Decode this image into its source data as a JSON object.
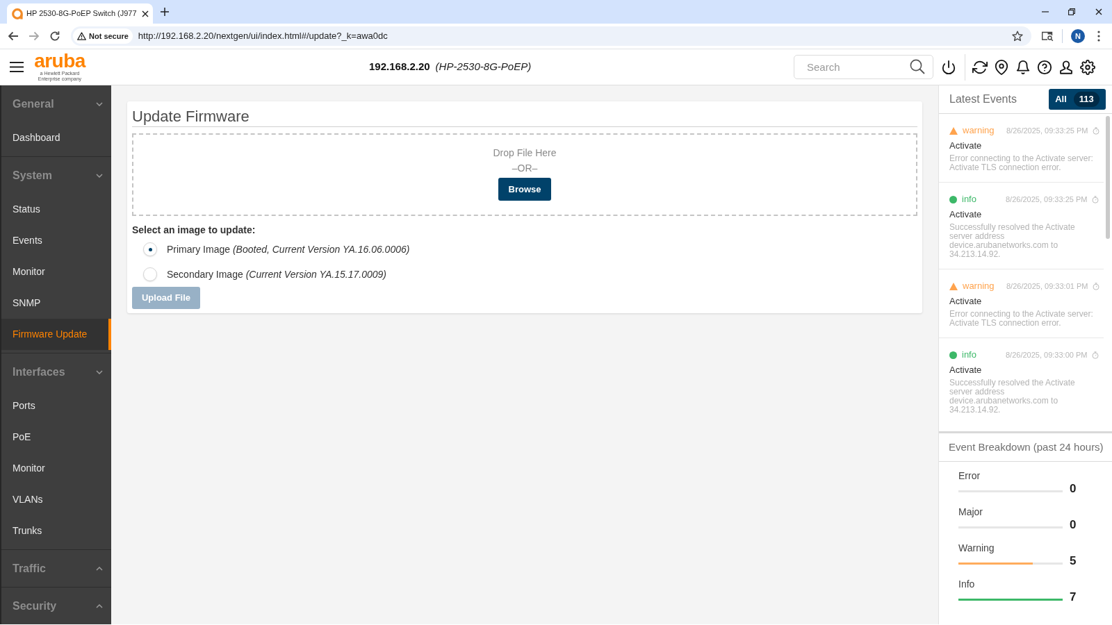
{
  "browser": {
    "tab": {
      "title": "HP 2530-8G-PoEP Switch (J977"
    },
    "security_chip": "Not secure",
    "url": "http://192.168.2.20/nextgen/ui/index.html#/update?_k=awa0dc",
    "profile_initial": "N"
  },
  "header": {
    "logo": {
      "wordmark": "aruba",
      "tagline": "a Hewlett Packard Enterprise company"
    },
    "device_address": "192.168.2.20",
    "device_model": "(HP-2530-8G-PoEP)",
    "search": {
      "placeholder": "Search"
    }
  },
  "sidebar": {
    "sections": [
      {
        "title": "General",
        "expanded": true,
        "items": [
          {
            "label": "Dashboard",
            "selected": false
          }
        ]
      },
      {
        "title": "System",
        "expanded": true,
        "items": [
          {
            "label": "Status",
            "selected": false
          },
          {
            "label": "Events",
            "selected": false
          },
          {
            "label": "Monitor",
            "selected": false
          },
          {
            "label": "SNMP",
            "selected": false
          },
          {
            "label": "Firmware Update",
            "selected": true
          }
        ]
      },
      {
        "title": "Interfaces",
        "expanded": true,
        "items": [
          {
            "label": "Ports",
            "selected": false
          },
          {
            "label": "PoE",
            "selected": false
          },
          {
            "label": "Monitor",
            "selected": false
          },
          {
            "label": "VLANs",
            "selected": false
          },
          {
            "label": "Trunks",
            "selected": false
          }
        ]
      },
      {
        "title": "Traffic",
        "expanded": false
      },
      {
        "title": "Security",
        "expanded": false
      }
    ]
  },
  "update_firmware": {
    "title": "Update Firmware",
    "dropzone": {
      "prompt": "Drop File Here",
      "separator": "–OR–",
      "browse_button": "Browse"
    },
    "image_select": {
      "label": "Select an image to update:",
      "options": [
        {
          "label": "Primary Image *(Booted, Current Version YA.16.06.0006)*",
          "selected": true
        },
        {
          "label": "Secondary Image *(Current Version YA.15.17.0009)*",
          "selected": false
        }
      ]
    },
    "upload_button": {
      "label": "Upload File",
      "disabled": true
    }
  },
  "latest_events": {
    "title": "Latest Events",
    "filter_button": {
      "label": "All",
      "count": "113"
    },
    "events": [
      {
        "kind": "warning",
        "color": "#ffa34d",
        "severity": "warning",
        "time": "8/26/2025, 09:33:25 PM",
        "source": "Activate",
        "message": "Error connecting to the Activate server: Activate TLS connection error."
      },
      {
        "kind": "info",
        "color": "#3cb868",
        "severity": "info",
        "time": "8/26/2025, 09:33:25 PM",
        "source": "Activate",
        "message": "Successfully resolved the Activate server address device.arubanetworks.com to 34.213.14.92."
      },
      {
        "kind": "warning",
        "color": "#ffa34d",
        "severity": "warning",
        "time": "8/26/2025, 09:33:01 PM",
        "source": "Activate",
        "message": "Error connecting to the Activate server: Activate TLS connection error."
      },
      {
        "kind": "info",
        "color": "#3cb868",
        "severity": "info",
        "time": "8/26/2025, 09:33:00 PM",
        "source": "Activate",
        "message": "Successfully resolved the Activate server address device.arubanetworks.com to 34.213.14.92."
      }
    ]
  },
  "event_breakdown": {
    "title": "Event Breakdown (past 24 hours)",
    "rows": [
      {
        "label": "Error",
        "value": "0",
        "level": 0
      },
      {
        "label": "Major",
        "value": "0",
        "level": 0
      },
      {
        "label": "Warning",
        "value": "5",
        "level": 0.71,
        "color": "#ffac5c"
      },
      {
        "label": "Info",
        "value": "7",
        "level": 1,
        "color": "#3cb868"
      }
    ]
  }
}
